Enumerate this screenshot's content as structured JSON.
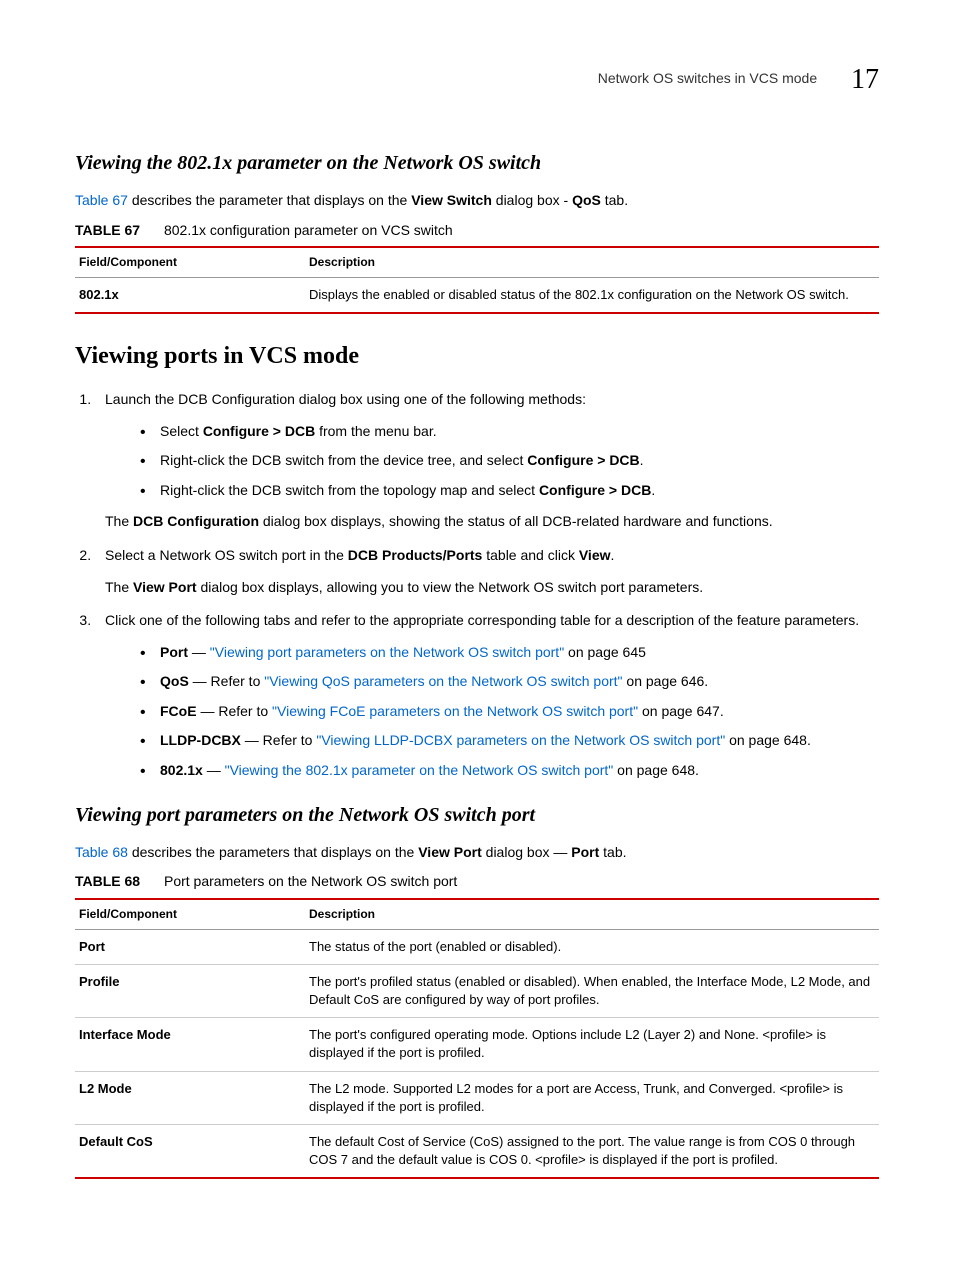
{
  "header": {
    "title": "Network OS switches in VCS mode",
    "chapter": "17"
  },
  "section1": {
    "heading": "Viewing the 802.1x parameter on the Network OS switch",
    "intro_link": "Table 67",
    "intro_mid": " describes the parameter that displays on the ",
    "intro_bold1": "View Switch",
    "intro_mid2": " dialog box - ",
    "intro_bold2": "QoS",
    "intro_end": " tab.",
    "table_label": "TABLE 67",
    "table_caption": "802.1x configuration parameter on VCS switch",
    "col1": "Field/Component",
    "col2": "Description",
    "row1_field": "802.1x",
    "row1_desc": "Displays the enabled or disabled status of the 802.1x configuration on the Network OS switch."
  },
  "section2": {
    "heading": "Viewing ports in VCS mode",
    "step1": "Launch the DCB Configuration dialog box using one of the following methods:",
    "step1_b1_a": "Select ",
    "step1_b1_b": "Configure > DCB",
    "step1_b1_c": " from the menu bar.",
    "step1_b2_a": "Right-click the DCB switch from the device tree, and select ",
    "step1_b2_b": "Configure > DCB",
    "step1_b2_c": ".",
    "step1_b3_a": "Right-click the DCB switch from the topology map and select ",
    "step1_b3_b": "Configure > DCB",
    "step1_b3_c": ".",
    "step1_note_a": "The ",
    "step1_note_b": "DCB Configuration",
    "step1_note_c": " dialog box displays, showing the status of all DCB-related hardware and functions.",
    "step2_a": "Select a Network OS switch port in the ",
    "step2_b": "DCB Products/Ports",
    "step2_c": " table and click ",
    "step2_d": "View",
    "step2_e": ".",
    "step2_note_a": "The ",
    "step2_note_b": "View Port",
    "step2_note_c": " dialog box displays, allowing you to view the Network OS switch port parameters.",
    "step3": "Click one of the following tabs and refer to the appropriate corresponding table for a description of the feature parameters.",
    "tab1_bold": "Port",
    "tab1_dash": " — ",
    "tab1_link": "\"Viewing port parameters on the Network OS switch port\"",
    "tab1_end": " on page 645",
    "tab2_bold": "QoS",
    "tab2_dash": " — Refer to ",
    "tab2_link": "\"Viewing QoS parameters on the Network OS switch port\"",
    "tab2_end": " on page 646.",
    "tab3_bold": "FCoE",
    "tab3_dash": " — Refer to ",
    "tab3_link": "\"Viewing FCoE parameters on the Network OS switch port\"",
    "tab3_end": " on page 647.",
    "tab4_bold": "LLDP-DCBX",
    "tab4_dash": " — Refer to ",
    "tab4_link": "\"Viewing LLDP-DCBX parameters on the Network OS switch port\"",
    "tab4_end": " on page 648.",
    "tab5_bold": "802.1x",
    "tab5_dash": " — ",
    "tab5_link": "\"Viewing the 802.1x parameter on the Network OS switch port\"",
    "tab5_end": " on page 648."
  },
  "section3": {
    "heading": "Viewing port parameters on the Network OS switch port",
    "intro_link": "Table 68",
    "intro_mid": " describes the parameters that displays on the ",
    "intro_bold1": "View Port",
    "intro_mid2": " dialog box — ",
    "intro_bold2": "Port",
    "intro_end": " tab.",
    "table_label": "TABLE 68",
    "table_caption": "Port parameters on the Network OS switch port",
    "col1": "Field/Component",
    "col2": "Description",
    "rows": [
      {
        "field": "Port",
        "desc": "The status of the port (enabled or disabled)."
      },
      {
        "field": "Profile",
        "desc": "The port's profiled status (enabled or disabled). When enabled, the Interface Mode, L2 Mode, and Default CoS are configured by way of port profiles."
      },
      {
        "field": "Interface Mode",
        "desc": "The port's configured operating mode. Options include L2 (Layer 2) and None. <profile> is displayed if the port is profiled."
      },
      {
        "field": "L2 Mode",
        "desc": "The L2 mode. Supported L2 modes for a port are Access, Trunk, and Converged. <profile> is displayed if the port is profiled."
      },
      {
        "field": "Default CoS",
        "desc": "The default Cost of Service (CoS) assigned to the port. The value range is from COS 0 through COS 7 and the default value is COS 0. <profile> is displayed if the port is profiled."
      }
    ]
  }
}
